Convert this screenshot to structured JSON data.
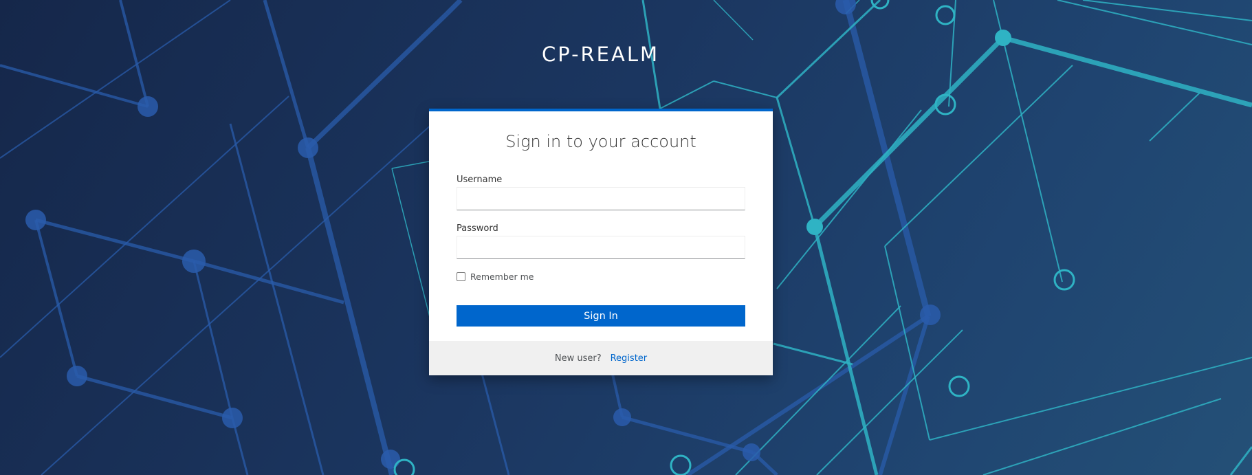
{
  "realm": {
    "title": "CP-REALM"
  },
  "login": {
    "heading": "Sign in to your account",
    "username_label": "Username",
    "username_value": "",
    "password_label": "Password",
    "password_value": "",
    "remember_label": "Remember me",
    "remember_checked": false,
    "submit_label": "Sign In"
  },
  "footer": {
    "new_user_text": "New user?",
    "register_label": "Register"
  },
  "colors": {
    "accent": "#0066cc",
    "background_dark": "#15274a",
    "background_light": "#245077",
    "network_line_cyan": "#2fb3c4",
    "network_line_blue": "#2a5cab"
  }
}
